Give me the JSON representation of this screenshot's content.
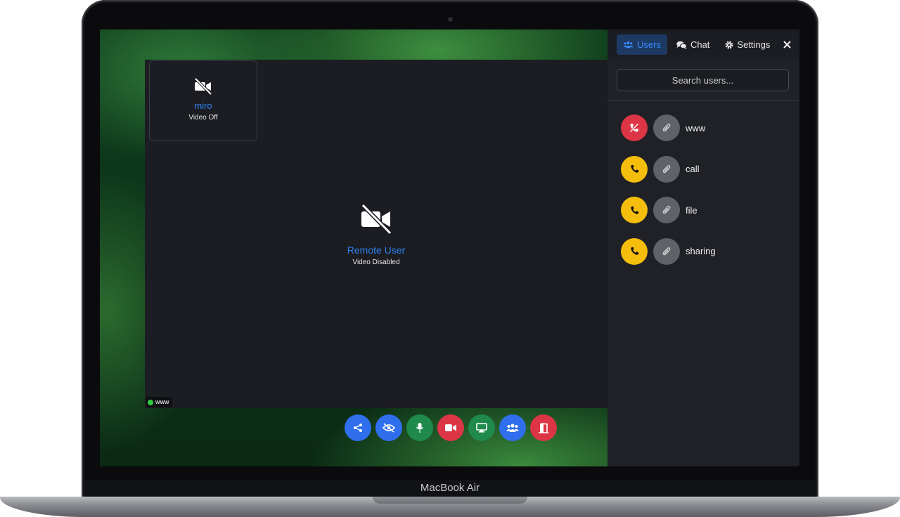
{
  "device": {
    "label": "MacBook Air"
  },
  "video": {
    "local": {
      "name": "miro",
      "status": "Video Off"
    },
    "remote": {
      "name": "Remote User",
      "status": "Video Disabled"
    },
    "connection_tag": "www"
  },
  "toolbar": {
    "buttons": [
      {
        "icon": "share-icon",
        "color": "#2f6fed"
      },
      {
        "icon": "eye-slash-icon",
        "color": "#2f6fed"
      },
      {
        "icon": "microphone-icon",
        "color": "#1f8a4c"
      },
      {
        "icon": "video-camera-icon",
        "color": "#dc3545"
      },
      {
        "icon": "screen-share-icon",
        "color": "#1f8a4c"
      },
      {
        "icon": "users-icon",
        "color": "#2f6fed"
      },
      {
        "icon": "leave-door-icon",
        "color": "#dc3545"
      }
    ]
  },
  "panel": {
    "tabs": {
      "users": "Users",
      "chat": "Chat",
      "settings": "Settings"
    },
    "active_tab": "Users",
    "search": {
      "placeholder": "Search users...",
      "value": ""
    },
    "users": [
      {
        "name": "www",
        "call_state": "hang-up",
        "call_color": "#dc3545"
      },
      {
        "name": "call",
        "call_state": "call",
        "call_color": "#f5bd0c"
      },
      {
        "name": "file",
        "call_state": "call",
        "call_color": "#f5bd0c"
      },
      {
        "name": "sharing",
        "call_state": "call",
        "call_color": "#f5bd0c"
      }
    ]
  },
  "colors": {
    "accent": "#2f80ed",
    "danger": "#dc3545",
    "warning": "#f5bd0c",
    "success": "#1f8a4c",
    "status_online": "#2ecc40"
  }
}
